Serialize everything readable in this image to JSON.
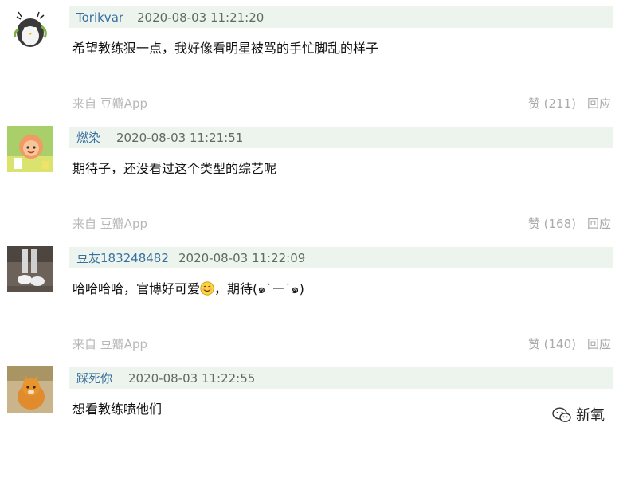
{
  "comments": [
    {
      "username": "Torikvar",
      "time": "2020-08-03 11:21:20",
      "content": "希望教练狠一点，我好像看明星被骂的手忙脚乱的样子",
      "source": "来自 豆瓣App",
      "like": "赞 (211)",
      "reply": "回应",
      "avatar_icon": "penguin-sticker-avatar"
    },
    {
      "username": "燃染",
      "time": "2020-08-03 11:21:51",
      "content": "期待子，还没看过这个类型的综艺呢",
      "source": "来自 豆瓣App",
      "like": "赞 (168)",
      "reply": "回应",
      "avatar_icon": "cartoon-character-avatar"
    },
    {
      "username": "豆友183248482",
      "time": "2020-08-03 11:22:09",
      "content_before": "哈哈哈哈，官博好可爱",
      "content_after": "，期待(๑˙ー˙๑)",
      "emoji_icon": "smiling-face-icon",
      "source": "来自 豆瓣App",
      "like": "赞 (140)",
      "reply": "回应",
      "avatar_icon": "sneakers-photo-avatar"
    },
    {
      "username": "踩死你",
      "time": "2020-08-03 11:22:55",
      "content": "想看教练喷他们",
      "avatar_icon": "orange-cat-photo-avatar"
    }
  ],
  "watermark": {
    "text": "新氧",
    "icon": "wechat-bubble-icon"
  },
  "colors": {
    "username": "#37709f",
    "header_bg": "#edf4ed",
    "muted": "#b8b8b8"
  }
}
